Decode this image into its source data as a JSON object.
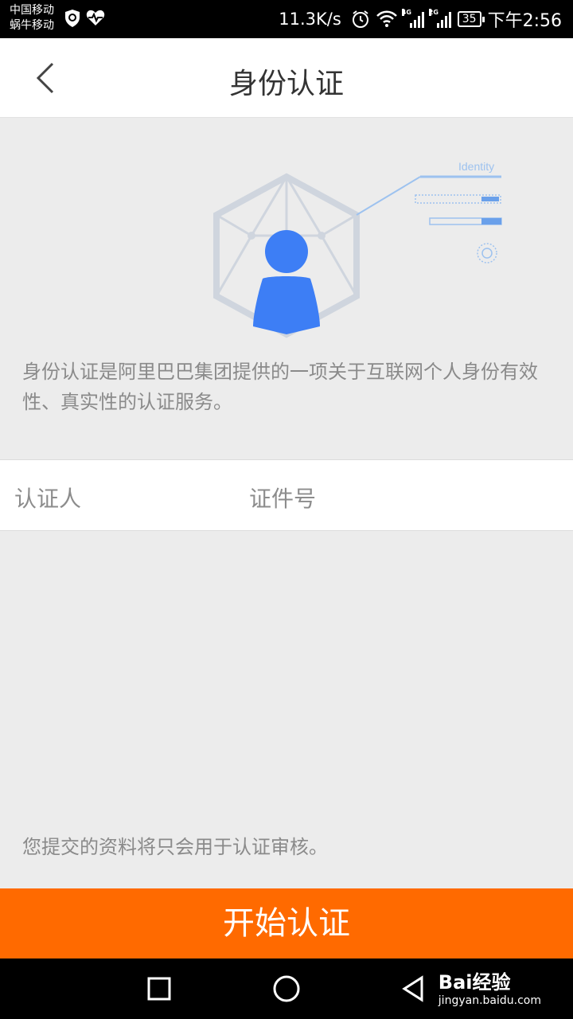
{
  "status_bar": {
    "carrier_1": "中国移动",
    "carrier_2": "蜗牛移动",
    "net_speed": "11.3K/s",
    "signal_1_tag": "4G",
    "signal_2_tag": "2G",
    "battery": "35",
    "time": "下午2:56"
  },
  "header": {
    "title": "身份认证"
  },
  "hero": {
    "identity_label": "Identity"
  },
  "description": "身份认证是阿里巴巴集团提供的一项关于互联网个人身份有效性、真实性的认证服务。",
  "info_row": {
    "certifier_label": "认证人",
    "id_number_label": "证件号"
  },
  "note": "您提交的资料将只会用于认证审核。",
  "start_button": "开始认证",
  "watermark": {
    "main": "Bai经验",
    "sub": "jingyan.baidu.com"
  },
  "colors": {
    "accent": "#ff6a00",
    "icon_blue": "#3d7ef5"
  }
}
